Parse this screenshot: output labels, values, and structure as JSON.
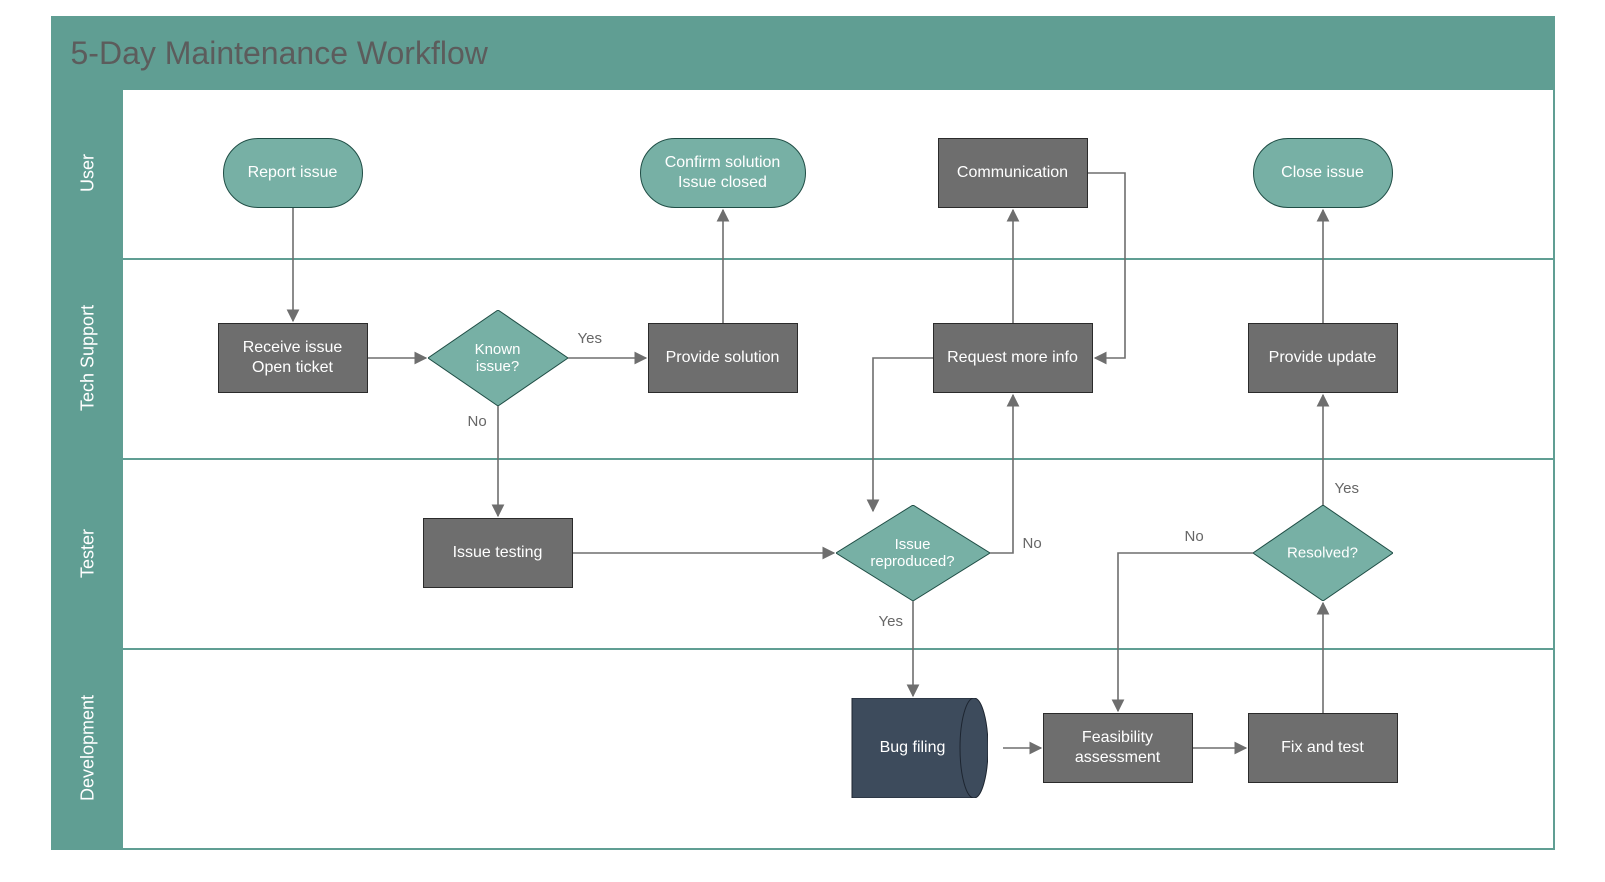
{
  "title": "5-Day Maintenance Workflow",
  "lanes": {
    "user": "User",
    "tech_support": "Tech Support",
    "tester": "Tester",
    "development": "Development"
  },
  "nodes": {
    "report_issue": "Report issue",
    "receive_issue_l1": "Receive issue",
    "receive_issue_l2": "Open ticket",
    "known_issue": "Known issue?",
    "provide_solution": "Provide solution",
    "confirm_l1": "Confirm solution",
    "confirm_l2": "Issue closed",
    "request_info": "Request more info",
    "communication": "Communication",
    "issue_testing": "Issue testing",
    "issue_reproduced": "Issue reproduced?",
    "bug_filing": "Bug filing",
    "feasibility": "Feasibility assessment",
    "fix_and_test": "Fix and test",
    "resolved": "Resolved?",
    "provide_update": "Provide update",
    "close_issue": "Close issue"
  },
  "edge_labels": {
    "yes": "Yes",
    "no": "No"
  }
}
